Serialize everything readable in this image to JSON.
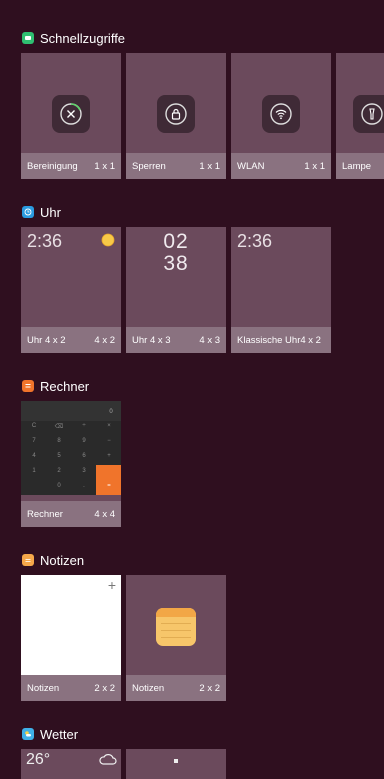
{
  "sections": {
    "quick": {
      "title": "Schnellzugriffe",
      "color": "#2fbf71",
      "tiles": [
        {
          "name": "Bereinigung",
          "size": "1 x 1",
          "icon": "cleanup-icon"
        },
        {
          "name": "Sperren",
          "size": "1 x 1",
          "icon": "lock-icon"
        },
        {
          "name": "WLAN",
          "size": "1 x 1",
          "icon": "wifi-icon"
        },
        {
          "name": "Lampe",
          "size": "",
          "icon": "flashlight-icon"
        }
      ]
    },
    "clock": {
      "title": "Uhr",
      "color": "#2a9be0",
      "tiles": [
        {
          "name": "Uhr 4 x 2",
          "size": "4 x 2",
          "time": "2:36"
        },
        {
          "name": "Uhr 4 x 3",
          "size": "4 x 3",
          "hours": "02",
          "minutes": "38"
        },
        {
          "name": "Klassische Uhr4 x 2",
          "size": "",
          "time": "2:36"
        }
      ]
    },
    "calc": {
      "title": "Rechner",
      "color": "#f0742b",
      "tiles": [
        {
          "name": "Rechner",
          "size": "4 x 4"
        }
      ],
      "display": "0",
      "keys": [
        "C",
        "⌫",
        "÷",
        "×",
        "7",
        "8",
        "9",
        "−",
        "4",
        "5",
        "6",
        "+",
        "1",
        "2",
        "3",
        "",
        "",
        "0",
        ".",
        "="
      ]
    },
    "notes": {
      "title": "Notizen",
      "color": "#f5a84a",
      "tiles": [
        {
          "name": "Notizen",
          "size": "2 x 2",
          "plus": "+"
        },
        {
          "name": "Notizen",
          "size": "2 x 2"
        }
      ]
    },
    "weather": {
      "title": "Wetter",
      "color": "#3fb0e8",
      "tiles": [
        {
          "temp": "26°"
        }
      ]
    }
  }
}
